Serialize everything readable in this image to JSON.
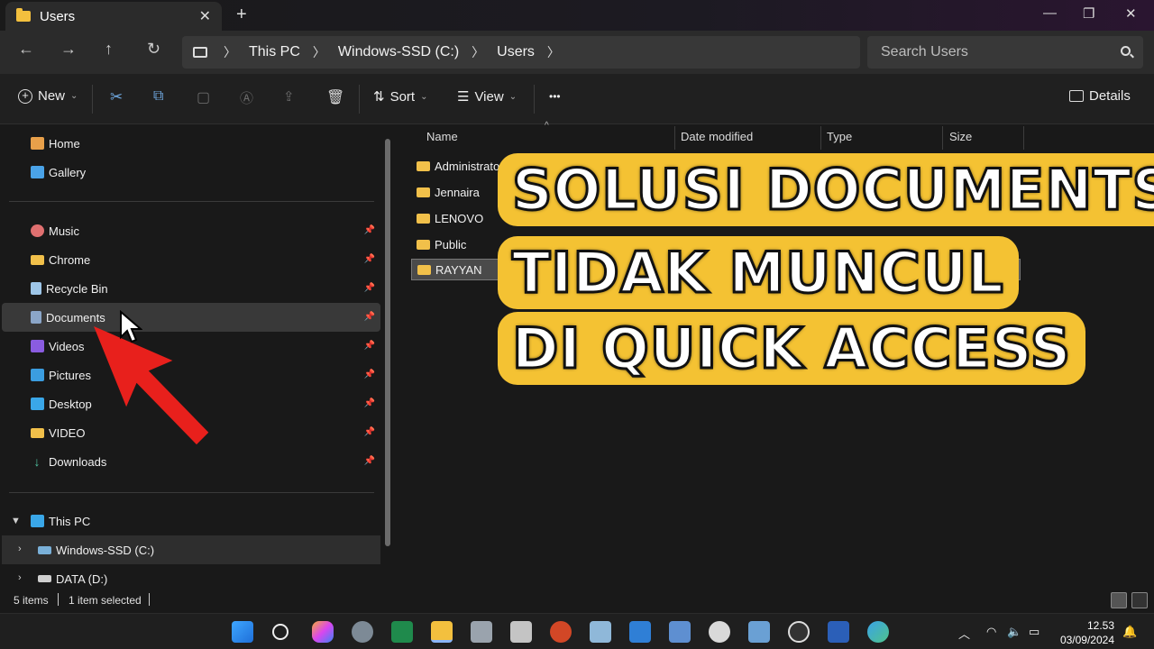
{
  "window": {
    "tab_title": "Users",
    "close_tab": "✕",
    "new_tab": "+",
    "minimize": "—",
    "maximize": "❐",
    "close": "✕"
  },
  "nav": {
    "back": "←",
    "forward": "→",
    "up": "↑",
    "refresh": "↻"
  },
  "address": {
    "crumbs": [
      "This PC",
      "Windows-SSD (C:)",
      "Users"
    ],
    "search_placeholder": "Search Users"
  },
  "toolbar": {
    "new_label": "New",
    "sort_label": "Sort",
    "view_label": "View",
    "more_label": "•••",
    "details_label": "Details"
  },
  "sidebar": {
    "top": [
      {
        "label": "Home",
        "icon": "home-icon",
        "color": "#e8a04a"
      },
      {
        "label": "Gallery",
        "icon": "gallery-icon",
        "color": "#4aa3e8"
      }
    ],
    "quick": [
      {
        "label": "Music",
        "icon": "music-icon",
        "color": "#e07070"
      },
      {
        "label": "Chrome",
        "icon": "folder-icon",
        "color": "#f1c04a"
      },
      {
        "label": "Recycle Bin",
        "icon": "recycle-bin-icon",
        "color": "#9ec6e8"
      },
      {
        "label": "Documents",
        "icon": "documents-icon",
        "color": "#8ba6c8"
      },
      {
        "label": "Videos",
        "icon": "videos-icon",
        "color": "#8a5ce0"
      },
      {
        "label": "Pictures",
        "icon": "pictures-icon",
        "color": "#3b9de0"
      },
      {
        "label": "Desktop",
        "icon": "desktop-icon",
        "color": "#3aa7e8"
      },
      {
        "label": "VIDEO",
        "icon": "folder-icon",
        "color": "#f1c04a"
      },
      {
        "label": "Downloads",
        "icon": "downloads-icon",
        "color": "#4fc3a1"
      }
    ],
    "this_pc": "This PC",
    "drives": [
      "Windows-SSD (C:)",
      "DATA (D:)"
    ]
  },
  "files": {
    "columns": [
      "Name",
      "Date modified",
      "Type",
      "Size"
    ],
    "rows": [
      "Administrator",
      "Jennaira",
      "LENOVO",
      "Public",
      "RAYYAN"
    ]
  },
  "overlay": {
    "line1": "SOLUSI  DOCUMENTS",
    "line2": "TIDAK  MUNCUL",
    "line3": "DI  QUICK  ACCESS"
  },
  "status": {
    "items": "5 items",
    "selected": "1 item selected"
  },
  "clock": {
    "time": "12.53",
    "date": "03/09/2024"
  }
}
